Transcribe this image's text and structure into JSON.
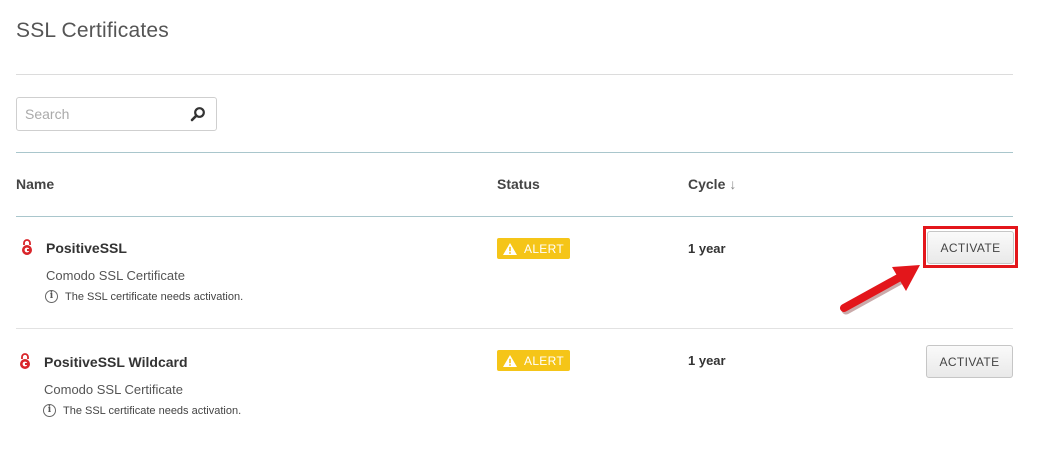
{
  "page": {
    "title": "SSL Certificates"
  },
  "search": {
    "placeholder": "Search"
  },
  "table": {
    "headers": {
      "name": "Name",
      "status": "Status",
      "cycle": "Cycle"
    },
    "rows": [
      {
        "name": "PositiveSSL",
        "subtitle": "Comodo SSL Certificate",
        "info": "The SSL certificate needs activation.",
        "status": "ALERT",
        "cycle": "1 year",
        "action": "ACTIVATE"
      },
      {
        "name": "PositiveSSL Wildcard",
        "subtitle": "Comodo SSL Certificate",
        "info": "The SSL certificate needs activation.",
        "status": "ALERT",
        "cycle": "1 year",
        "action": "ACTIVATE"
      }
    ]
  },
  "colors": {
    "alert_badge": "#f5c518",
    "brand_icon": "#d9252a",
    "annotation": "#e3161b"
  },
  "icons": [
    "search-icon",
    "sort-down-icon",
    "ssl-lock-icon",
    "info-icon",
    "warning-icon",
    "annotation-arrow"
  ]
}
